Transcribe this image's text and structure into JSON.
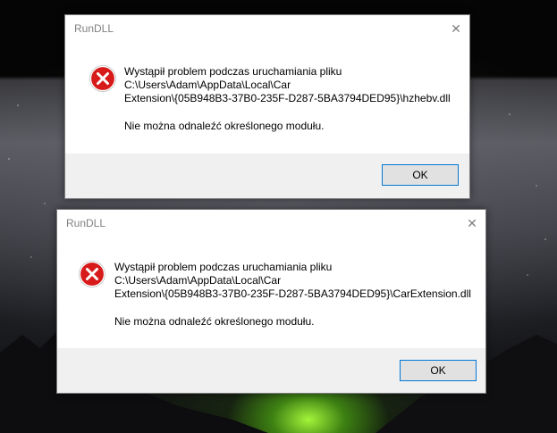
{
  "dialogs": [
    {
      "title": "RunDLL",
      "close_glyph": "✕",
      "message_line1": "Wystąpił problem podczas uruchamiania pliku",
      "message_line2": "C:\\Users\\Adam\\AppData\\Local\\Car",
      "message_line3": "Extension\\{05B948B3-37B0-235F-D287-5BA3794DED95}\\hzhebv.dll",
      "error_detail": "Nie można odnaleźć określonego modułu.",
      "ok_label": "OK",
      "icon": "error-icon"
    },
    {
      "title": "RunDLL",
      "close_glyph": "✕",
      "message_line1": "Wystąpił problem podczas uruchamiania pliku",
      "message_line2": "C:\\Users\\Adam\\AppData\\Local\\Car",
      "message_line3": "Extension\\{05B948B3-37B0-235F-D287-5BA3794DED95}\\CarExtension.dll",
      "error_detail": "Nie można odnaleźć określonego modułu.",
      "ok_label": "OK",
      "icon": "error-icon"
    }
  ],
  "colors": {
    "error_red": "#e81123",
    "title_gray": "#808080",
    "focus_blue": "#0078d7"
  }
}
